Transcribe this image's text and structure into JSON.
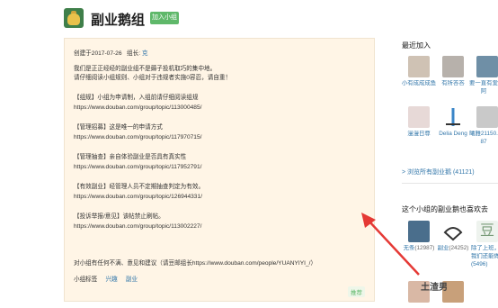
{
  "header": {
    "title": "副业鹅组",
    "join_label": "加入小组"
  },
  "content": {
    "created_prefix": "创建于2017-07-26",
    "owner_label": "组长:",
    "owner_name": "克",
    "intro1": "我们是正正经经的副业组不是薅子投机取巧的集中地。",
    "intro2": "请仔细阅读小组规则、小组对于违规者实施0容忍，请自重！",
    "s1_title": "【组规】小组为申请制，入组前请仔细阅读组规",
    "s1_link": "https://www.douban.com/group/topic/113000485/",
    "s2_title": "【管理招募】这是唯一的申请方式",
    "s2_link": "https://www.douban.com/group/topic/117970715/",
    "s3_title": "【管理抽查】亲自体验副业是否具有真实性",
    "s3_link": "https://www.douban.com/group/topic/117952791/",
    "s4_title": "【有效副业】经管理人员不定期抽查判定为有效。",
    "s4_link": "https://www.douban.com/group/topic/126944331/",
    "s5_title": "【投诉举报/意见】该帖禁止刷帖。",
    "s5_link": "https://www.douban.com/group/topic/113002227/",
    "feedback": "对小组有任何不满、意见和建议（请豆邮组长https://www.douban.com/people/YUANYIYI_/）",
    "tags_label": "小组标签",
    "tag1": "兴趣",
    "tag2": "副业",
    "recommend": "推荐"
  },
  "sidebar": {
    "recent_title": "最近加入",
    "row1": [
      {
        "name": "小有成成成鱼"
      },
      {
        "name": "有所答答"
      },
      {
        "name": "要一直有爱"
      },
      {
        "name": "阿"
      }
    ],
    "row2": [
      {
        "name": "漫漫日尊"
      },
      {
        "name": "Delia Deng"
      },
      {
        "name": "曦雅21150."
      },
      {
        "name": "87"
      }
    ],
    "browse_all": "> 浏览所有副业鹅 (41121)",
    "related_title": "这个小组的副业鹅也喜欢去",
    "related": [
      {
        "name": "无条",
        "count": "(12987)"
      },
      {
        "name": "副业",
        "count": "(24252)"
      },
      {
        "name": "除了上班，",
        "count": "我们还能做..."
      },
      {
        "name": "赚...",
        "count": "(5496)"
      }
    ]
  },
  "watermark": "土渣男"
}
